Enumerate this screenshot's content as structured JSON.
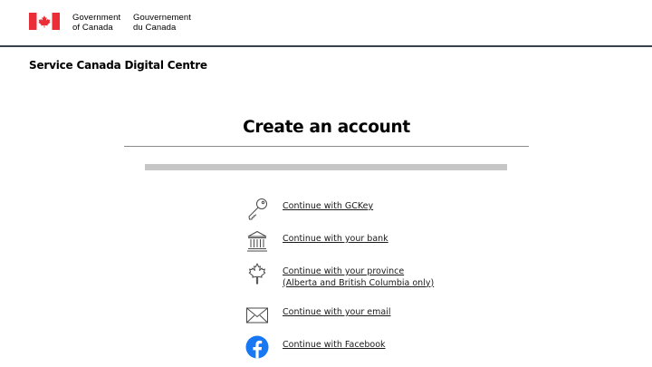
{
  "header": {
    "government_en": [
      "Government",
      "of Canada"
    ],
    "government_fr": [
      "Gouvernement",
      "du Canada"
    ]
  },
  "service": {
    "title": "Service Canada Digital Centre"
  },
  "main": {
    "title": "Create an account",
    "progress_fraction": 0
  },
  "options": [
    {
      "label": "Continue with GCKey",
      "icon": "key-icon"
    },
    {
      "label": "Continue with your bank",
      "icon": "bank-icon"
    },
    {
      "label_lines": [
        "Continue with your province ",
        "(Alberta and British Columbia only)"
      ],
      "icon": "maple-leaf-icon"
    },
    {
      "label": "Continue with your email",
      "icon": "envelope-icon"
    },
    {
      "label": "Continue with Facebook",
      "icon": "facebook-icon"
    }
  ],
  "colors": {
    "flag_red": "#eb2d37",
    "header_rule": "#38414d",
    "facebook_blue": "#1877f2",
    "progress_track": "#c6c6c6"
  }
}
